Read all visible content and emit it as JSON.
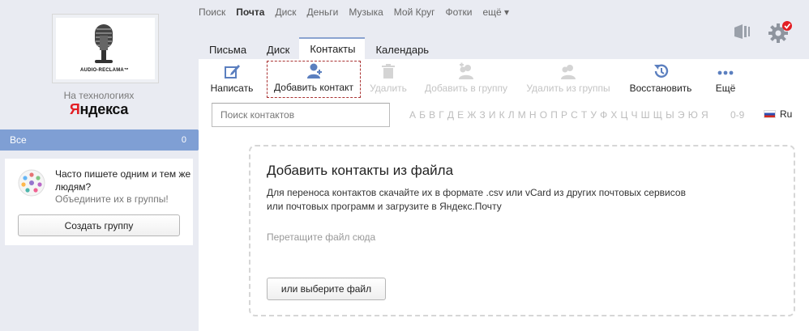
{
  "services": {
    "items": [
      "Поиск",
      "Почта",
      "Диск",
      "Деньги",
      "Музыка",
      "Мой Круг",
      "Фотки",
      "ещё ▾"
    ],
    "active": "Почта"
  },
  "sidebar": {
    "logo_caption": "AUDIO-RECLAMA™",
    "tech_label": "На технологиях",
    "yandex_first": "Я",
    "yandex_rest": "ндекса",
    "folder_all": {
      "label": "Все",
      "count": "0"
    },
    "promo": {
      "title": "Часто пишете одним и тем же людям?",
      "subtitle": "Объедините их в группы!",
      "button": "Создать группу"
    }
  },
  "tabs": [
    {
      "label": "Письма",
      "active": false
    },
    {
      "label": "Диск",
      "active": false
    },
    {
      "label": "Контакты",
      "active": true
    },
    {
      "label": "Календарь",
      "active": false
    }
  ],
  "toolbar": {
    "compose": "Написать",
    "add_contact": "Добавить контакт",
    "delete": "Удалить",
    "add_to_group": "Добавить в группу",
    "remove_from_group": "Удалить из группы",
    "restore": "Восстановить",
    "more": "Ещё"
  },
  "search": {
    "placeholder": "Поиск контактов"
  },
  "alphabet": "А Б В Г Д Е Ж З И К Л М Н О П Р С Т У Ф Х Ц Ч Ш Щ Ы Э Ю Я",
  "digits": "0-9",
  "lang": "Ru",
  "import": {
    "title": "Добавить контакты из файла",
    "description": "Для переноса контактов скачайте их в формате .csv или vCard из других почтовых сервисов или почтовых программ и загрузите в Яндекс.Почту",
    "drop_hint": "Перетащите файл сюда",
    "choose_button": "или выберите файл"
  },
  "colors": {
    "accent": "#7f9fd4",
    "background": "#e9ebf2",
    "notification": "#e31e24"
  },
  "icons": [
    "microphone-logo-icon",
    "group-people-icon",
    "compose-icon",
    "add-contact-icon",
    "trash-icon",
    "add-to-group-icon",
    "remove-from-group-icon",
    "restore-icon",
    "more-dots-icon",
    "panel-icon",
    "settings-gear-icon",
    "russia-flag-icon"
  ]
}
